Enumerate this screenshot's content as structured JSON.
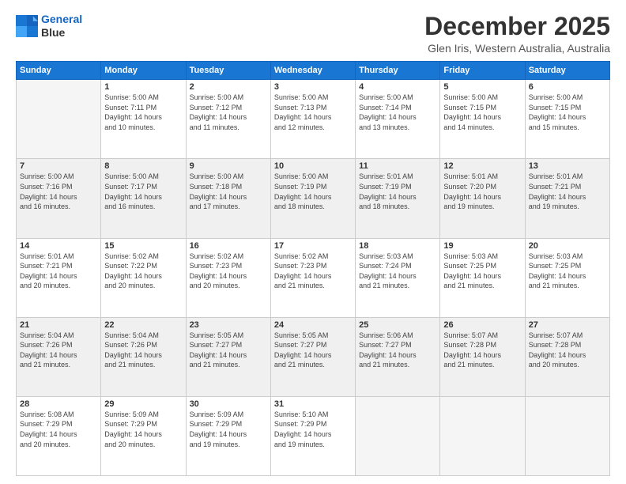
{
  "logo": {
    "line1": "General",
    "line2": "Blue"
  },
  "title": "December 2025",
  "subtitle": "Glen Iris, Western Australia, Australia",
  "weekdays": [
    "Sunday",
    "Monday",
    "Tuesday",
    "Wednesday",
    "Thursday",
    "Friday",
    "Saturday"
  ],
  "weeks": [
    [
      {
        "day": "",
        "info": ""
      },
      {
        "day": "1",
        "info": "Sunrise: 5:00 AM\nSunset: 7:11 PM\nDaylight: 14 hours\nand 10 minutes."
      },
      {
        "day": "2",
        "info": "Sunrise: 5:00 AM\nSunset: 7:12 PM\nDaylight: 14 hours\nand 11 minutes."
      },
      {
        "day": "3",
        "info": "Sunrise: 5:00 AM\nSunset: 7:13 PM\nDaylight: 14 hours\nand 12 minutes."
      },
      {
        "day": "4",
        "info": "Sunrise: 5:00 AM\nSunset: 7:14 PM\nDaylight: 14 hours\nand 13 minutes."
      },
      {
        "day": "5",
        "info": "Sunrise: 5:00 AM\nSunset: 7:15 PM\nDaylight: 14 hours\nand 14 minutes."
      },
      {
        "day": "6",
        "info": "Sunrise: 5:00 AM\nSunset: 7:15 PM\nDaylight: 14 hours\nand 15 minutes."
      }
    ],
    [
      {
        "day": "7",
        "info": "Sunrise: 5:00 AM\nSunset: 7:16 PM\nDaylight: 14 hours\nand 16 minutes."
      },
      {
        "day": "8",
        "info": "Sunrise: 5:00 AM\nSunset: 7:17 PM\nDaylight: 14 hours\nand 16 minutes."
      },
      {
        "day": "9",
        "info": "Sunrise: 5:00 AM\nSunset: 7:18 PM\nDaylight: 14 hours\nand 17 minutes."
      },
      {
        "day": "10",
        "info": "Sunrise: 5:00 AM\nSunset: 7:19 PM\nDaylight: 14 hours\nand 18 minutes."
      },
      {
        "day": "11",
        "info": "Sunrise: 5:01 AM\nSunset: 7:19 PM\nDaylight: 14 hours\nand 18 minutes."
      },
      {
        "day": "12",
        "info": "Sunrise: 5:01 AM\nSunset: 7:20 PM\nDaylight: 14 hours\nand 19 minutes."
      },
      {
        "day": "13",
        "info": "Sunrise: 5:01 AM\nSunset: 7:21 PM\nDaylight: 14 hours\nand 19 minutes."
      }
    ],
    [
      {
        "day": "14",
        "info": "Sunrise: 5:01 AM\nSunset: 7:21 PM\nDaylight: 14 hours\nand 20 minutes."
      },
      {
        "day": "15",
        "info": "Sunrise: 5:02 AM\nSunset: 7:22 PM\nDaylight: 14 hours\nand 20 minutes."
      },
      {
        "day": "16",
        "info": "Sunrise: 5:02 AM\nSunset: 7:23 PM\nDaylight: 14 hours\nand 20 minutes."
      },
      {
        "day": "17",
        "info": "Sunrise: 5:02 AM\nSunset: 7:23 PM\nDaylight: 14 hours\nand 21 minutes."
      },
      {
        "day": "18",
        "info": "Sunrise: 5:03 AM\nSunset: 7:24 PM\nDaylight: 14 hours\nand 21 minutes."
      },
      {
        "day": "19",
        "info": "Sunrise: 5:03 AM\nSunset: 7:25 PM\nDaylight: 14 hours\nand 21 minutes."
      },
      {
        "day": "20",
        "info": "Sunrise: 5:03 AM\nSunset: 7:25 PM\nDaylight: 14 hours\nand 21 minutes."
      }
    ],
    [
      {
        "day": "21",
        "info": "Sunrise: 5:04 AM\nSunset: 7:26 PM\nDaylight: 14 hours\nand 21 minutes."
      },
      {
        "day": "22",
        "info": "Sunrise: 5:04 AM\nSunset: 7:26 PM\nDaylight: 14 hours\nand 21 minutes."
      },
      {
        "day": "23",
        "info": "Sunrise: 5:05 AM\nSunset: 7:27 PM\nDaylight: 14 hours\nand 21 minutes."
      },
      {
        "day": "24",
        "info": "Sunrise: 5:05 AM\nSunset: 7:27 PM\nDaylight: 14 hours\nand 21 minutes."
      },
      {
        "day": "25",
        "info": "Sunrise: 5:06 AM\nSunset: 7:27 PM\nDaylight: 14 hours\nand 21 minutes."
      },
      {
        "day": "26",
        "info": "Sunrise: 5:07 AM\nSunset: 7:28 PM\nDaylight: 14 hours\nand 21 minutes."
      },
      {
        "day": "27",
        "info": "Sunrise: 5:07 AM\nSunset: 7:28 PM\nDaylight: 14 hours\nand 20 minutes."
      }
    ],
    [
      {
        "day": "28",
        "info": "Sunrise: 5:08 AM\nSunset: 7:29 PM\nDaylight: 14 hours\nand 20 minutes."
      },
      {
        "day": "29",
        "info": "Sunrise: 5:09 AM\nSunset: 7:29 PM\nDaylight: 14 hours\nand 20 minutes."
      },
      {
        "day": "30",
        "info": "Sunrise: 5:09 AM\nSunset: 7:29 PM\nDaylight: 14 hours\nand 19 minutes."
      },
      {
        "day": "31",
        "info": "Sunrise: 5:10 AM\nSunset: 7:29 PM\nDaylight: 14 hours\nand 19 minutes."
      },
      {
        "day": "",
        "info": ""
      },
      {
        "day": "",
        "info": ""
      },
      {
        "day": "",
        "info": ""
      }
    ]
  ]
}
